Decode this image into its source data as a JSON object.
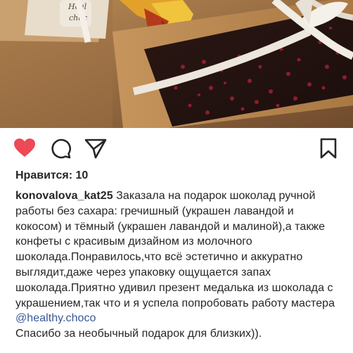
{
  "post": {
    "photo_text": [
      "Heal",
      "choc"
    ],
    "likes_label": "Нравится: 10",
    "username": "konovalova_kat25",
    "caption_main": "Заказала на подарок шоколад ручной работы без сахара: гречишный (украшен лавандой и кокосом) и тёмный (украшен лавандой и малиной),а также конфеты с красивым дизайном из молочного шоколада.Понравилось,что всё эстетично и аккуратно выглядит,даже через упаковку ощущается запах шоколада.Приятно удивил презент медалька из шоколада с украшением,так что и я успела попробовать работу мастера",
    "mention": "@healthy.choco",
    "caption_end": "Спасибо за необычный подарок для близких))."
  },
  "icons": {
    "like": "heart-icon",
    "comment": "comment-icon",
    "share": "send-icon",
    "save": "bookmark-icon"
  },
  "colors": {
    "like_active": "#ed4956",
    "text": "#262626",
    "mention": "#385898"
  }
}
